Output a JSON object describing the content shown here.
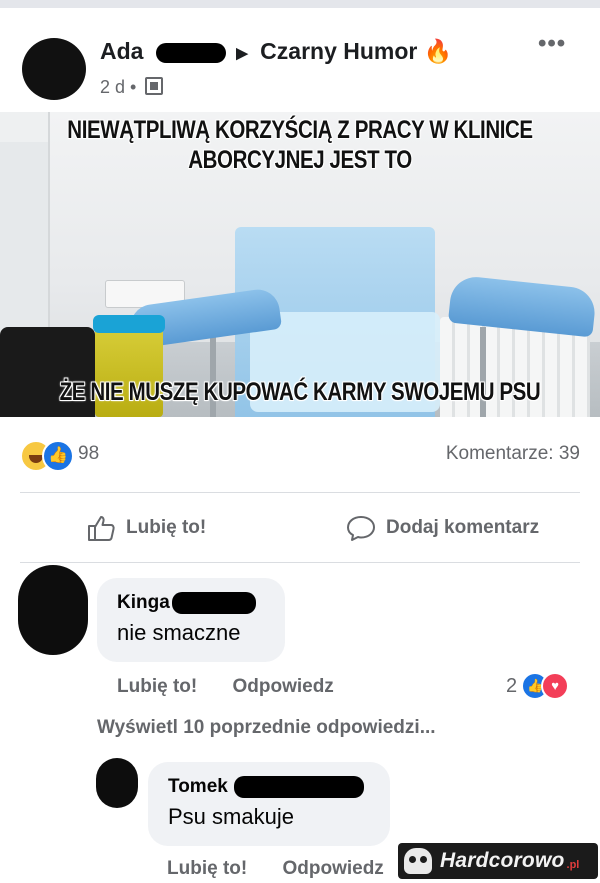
{
  "post": {
    "author_first": "Ada",
    "group": "Czarny Humor",
    "group_emoji": "🔥",
    "time": "2 d",
    "more": "•••",
    "meme_top_line1": "NIEWĄTPLIWĄ KORZYŚCIĄ Z PRACY W KLINICE",
    "meme_top_line2": "ABORCYJNEJ JEST TO",
    "meme_bottom": "ŻE NIE MUSZĘ KUPOWAĆ KARMY SWOJEMU PSU",
    "reaction_count": "98",
    "comments_label": "Komentarze: 39"
  },
  "actions": {
    "like": "Lubię to!",
    "comment": "Dodaj komentarz"
  },
  "comments": [
    {
      "name": "Kinga",
      "text": "nie smaczne",
      "like": "Lubię to!",
      "reply": "Odpowiedz",
      "reactions": "2"
    }
  ],
  "previous_replies": "Wyświetl 10 poprzednie odpowiedzi...",
  "reply": {
    "name": "Tomek",
    "text": "Psu smakuje",
    "like": "Lubię to!",
    "reply": "Odpowiedz"
  },
  "watermark": {
    "text": "Hardcorowo",
    "suffix": ".pl"
  }
}
